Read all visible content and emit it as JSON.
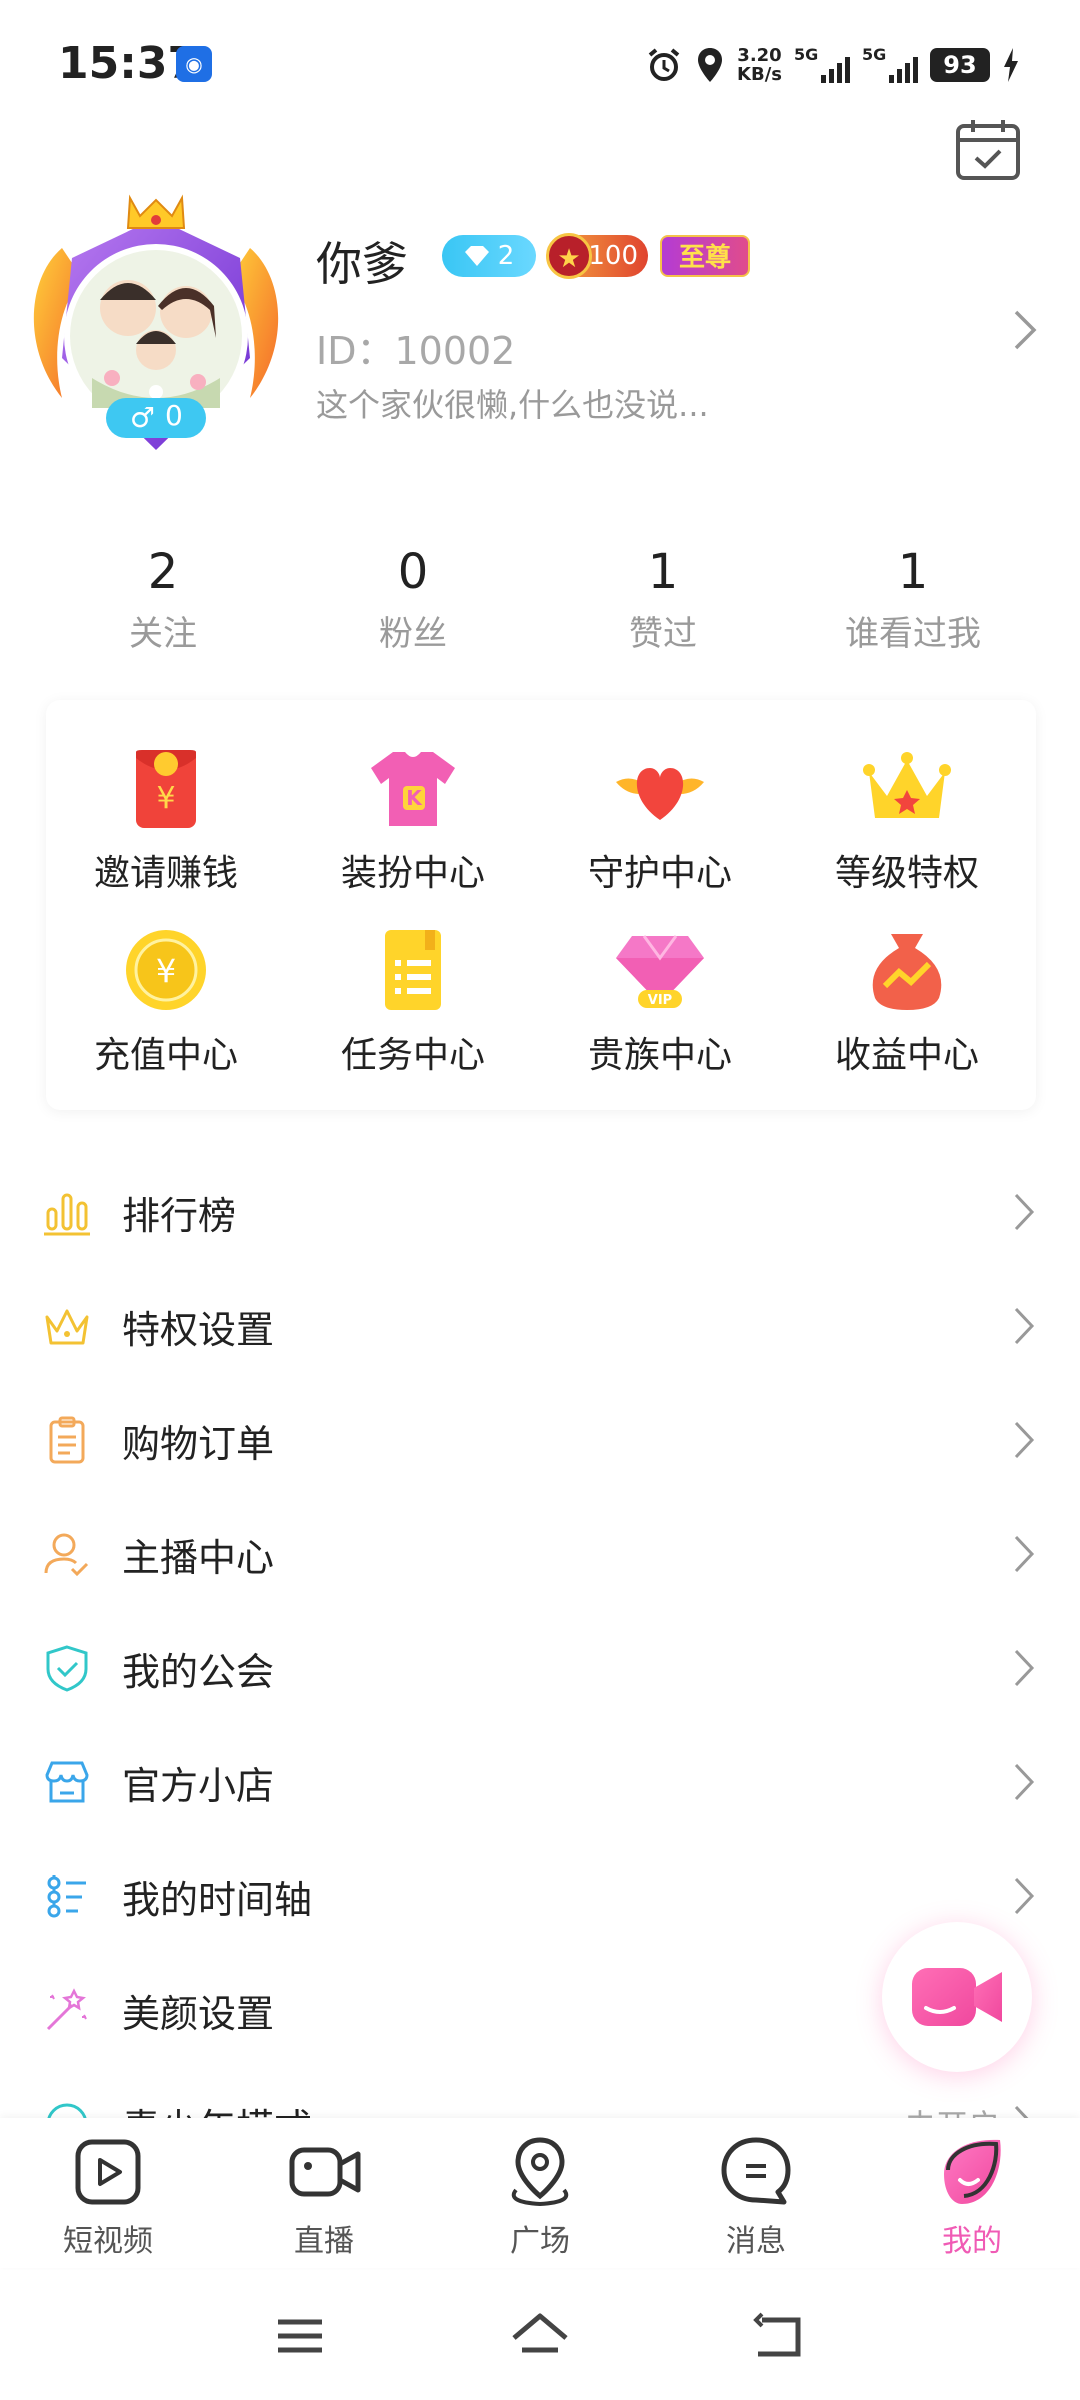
{
  "status_bar": {
    "time": "15:37",
    "speed_value": "3.20",
    "speed_unit": "KB/s",
    "signal1": "5G",
    "signal2": "5G",
    "battery": "93",
    "icons": [
      "cast-icon",
      "alarm-icon",
      "location-icon",
      "charging-icon"
    ]
  },
  "profile": {
    "name": "你爹",
    "level_badge": "2",
    "wealth_badge": "100",
    "vip_badge": "至尊",
    "gender_count": "0",
    "id_text": "ID：10002",
    "bio": "这个家伙很懒,什么也没说..."
  },
  "stats": [
    {
      "value": "2",
      "label": "关注"
    },
    {
      "value": "0",
      "label": "粉丝"
    },
    {
      "value": "1",
      "label": "赞过"
    },
    {
      "value": "1",
      "label": "谁看过我"
    }
  ],
  "grid": [
    {
      "label": "邀请赚钱",
      "icon": "red-envelope-icon"
    },
    {
      "label": "装扮中心",
      "icon": "tshirt-icon"
    },
    {
      "label": "守护中心",
      "icon": "winged-heart-icon"
    },
    {
      "label": "等级特权",
      "icon": "crown-icon"
    },
    {
      "label": "充值中心",
      "icon": "gold-coin-icon"
    },
    {
      "label": "任务中心",
      "icon": "task-book-icon"
    },
    {
      "label": "贵族中心",
      "icon": "vip-diamond-icon"
    },
    {
      "label": "收益中心",
      "icon": "money-bag-icon"
    }
  ],
  "menu": [
    {
      "label": "排行榜",
      "icon": "ranking-icon",
      "value": ""
    },
    {
      "label": "特权设置",
      "icon": "crown-outline-icon",
      "value": ""
    },
    {
      "label": "购物订单",
      "icon": "clipboard-icon",
      "value": ""
    },
    {
      "label": "主播中心",
      "icon": "anchor-user-icon",
      "value": ""
    },
    {
      "label": "我的公会",
      "icon": "shield-check-icon",
      "value": ""
    },
    {
      "label": "官方小店",
      "icon": "store-icon",
      "value": ""
    },
    {
      "label": "我的时间轴",
      "icon": "timeline-icon",
      "value": ""
    },
    {
      "label": "美颜设置",
      "icon": "magic-wand-icon",
      "value": ""
    },
    {
      "label": "青少年模式",
      "icon": "youth-mode-icon",
      "value": "未开启"
    }
  ],
  "bottom_nav": [
    {
      "label": "短视频",
      "icon": "short-video-icon"
    },
    {
      "label": "直播",
      "icon": "live-camera-icon"
    },
    {
      "label": "广场",
      "icon": "square-location-icon"
    },
    {
      "label": "消息",
      "icon": "message-icon"
    },
    {
      "label": "我的",
      "icon": "me-icon",
      "active": true
    }
  ],
  "colors": {
    "accent_pink": "#f05bb5",
    "icon_yellow": "#f3c233",
    "icon_teal": "#31c7c9",
    "icon_blue": "#3aa6ea"
  }
}
